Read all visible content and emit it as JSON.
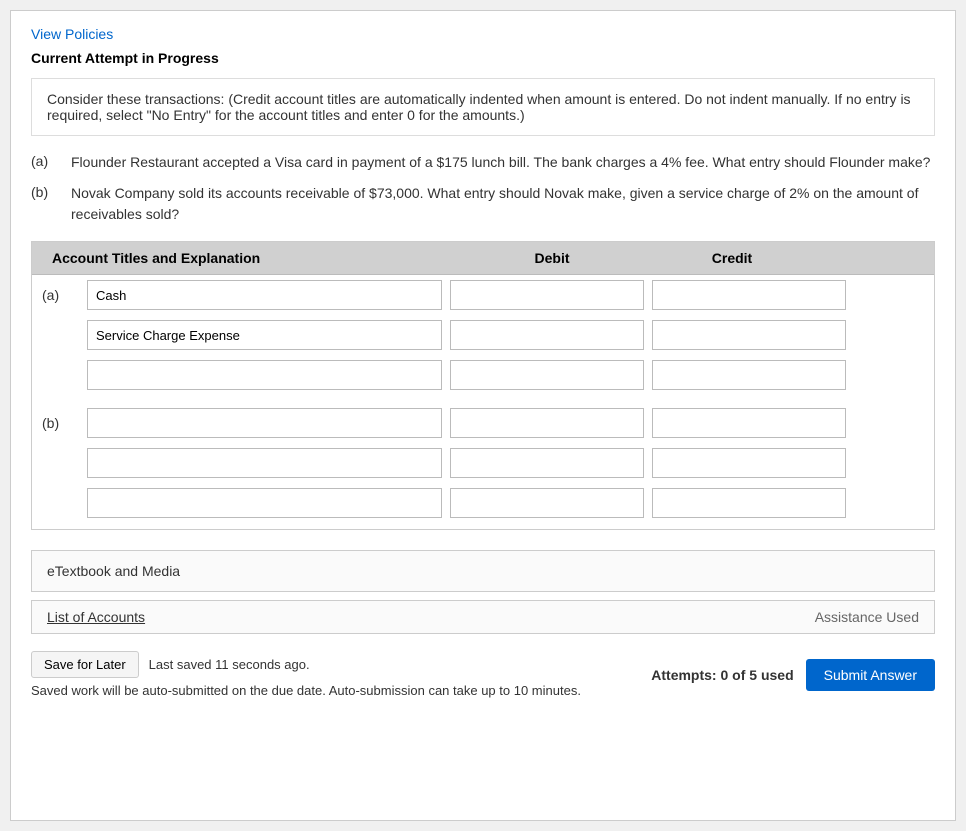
{
  "header": {
    "view_policies_label": "View Policies",
    "current_attempt_label": "Current Attempt in Progress"
  },
  "instructions": {
    "prefix": "Consider these transactions: ",
    "red_text": "(Credit account titles are automatically indented when amount is entered. Do not indent manually. If no entry is required, select \"No Entry\" for the account titles and enter 0 for the amounts.)"
  },
  "questions": [
    {
      "label": "(a)",
      "text": "Flounder Restaurant accepted a Visa card in payment of a $175 lunch bill. The bank charges a 4% fee. What entry should Flounder make?"
    },
    {
      "label": "(b)",
      "text": "Novak Company sold its accounts receivable of $73,000. What entry should Novak make, given a service charge of 2% on the amount of receivables sold?"
    }
  ],
  "table": {
    "col_account": "Account Titles and Explanation",
    "col_debit": "Debit",
    "col_credit": "Credit",
    "rows_a": [
      {
        "label": "(a)",
        "account_value": "Cash",
        "debit_value": "",
        "credit_value": ""
      },
      {
        "label": "",
        "account_value": "Service Charge Expense",
        "debit_value": "",
        "credit_value": ""
      },
      {
        "label": "",
        "account_value": "",
        "debit_value": "",
        "credit_value": ""
      }
    ],
    "rows_b": [
      {
        "label": "(b)",
        "account_value": "",
        "debit_value": "",
        "credit_value": ""
      },
      {
        "label": "",
        "account_value": "",
        "debit_value": "",
        "credit_value": ""
      },
      {
        "label": "",
        "account_value": "",
        "debit_value": "",
        "credit_value": ""
      }
    ]
  },
  "etextbook": {
    "label": "eTextbook and Media"
  },
  "list_accounts": {
    "label": "List of Accounts",
    "assistance_label": "Assistance Used"
  },
  "footer": {
    "save_later_label": "Save for Later",
    "last_saved_text": "Last saved 11 seconds ago.",
    "auto_submit_text": "Saved work will be auto-submitted on the due date. Auto-submission can take up to 10 minutes.",
    "attempts_text": "Attempts: 0 of 5 used",
    "submit_label": "Submit Answer"
  }
}
